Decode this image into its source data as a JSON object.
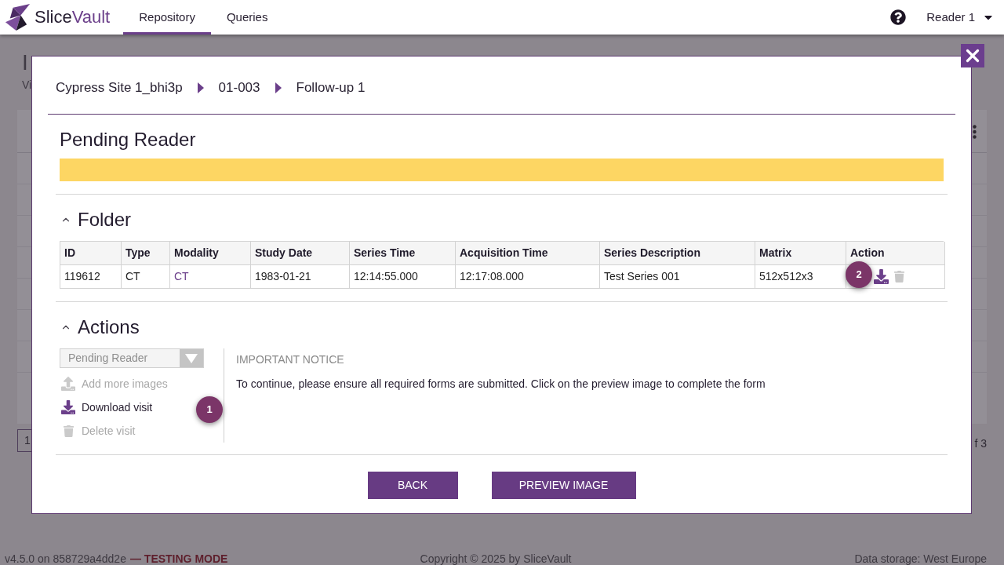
{
  "header": {
    "logo": {
      "text_start": "Slice",
      "text_end": "Vault"
    },
    "tabs": [
      {
        "label": "Repository",
        "selected": true
      },
      {
        "label": "Queries",
        "selected": false
      }
    ],
    "user_menu": {
      "label": "Reader 1"
    }
  },
  "background_page": {
    "title": "I",
    "subtitle": "Vi",
    "pagination": {
      "page": "1",
      "page_count": "f 3"
    }
  },
  "modal": {
    "breadcrumb": [
      "Cypress Site 1_bhi3p",
      "01-003",
      "Follow-up 1"
    ],
    "status_title": "Pending Reader",
    "folder": {
      "title": "Folder",
      "expanded": true,
      "table": {
        "columns": [
          "ID",
          "Type",
          "Modality",
          "Study Date",
          "Series Time",
          "Acquisition Time",
          "Series Description",
          "Matrix",
          "Action"
        ],
        "rows": [
          {
            "cells": [
              {
                "text": "119612",
                "kind": "text"
              },
              {
                "text": "CT",
                "kind": "text"
              },
              {
                "text": "CT",
                "kind": "link"
              },
              {
                "text": "1983-01-21",
                "kind": "text"
              },
              {
                "text": "12:14:55.000",
                "kind": "text"
              },
              {
                "text": "12:17:08.000",
                "kind": "text"
              },
              {
                "text": "Test Series 001",
                "kind": "text"
              },
              {
                "text": "512x512x3",
                "kind": "text"
              }
            ],
            "actions": [
              {
                "kind": "download",
                "disabled": false
              },
              {
                "kind": "delete",
                "disabled": true
              }
            ],
            "tour_marker": "2"
          }
        ]
      }
    },
    "actions": {
      "title": "Actions",
      "expanded": true,
      "status_select": {
        "value": "Pending Reader",
        "disabled": true
      },
      "items": [
        {
          "label": "Add more images",
          "kind": "upload",
          "disabled": true
        },
        {
          "label": "Download visit",
          "kind": "download",
          "disabled": false
        },
        {
          "label": "Delete visit",
          "kind": "delete",
          "disabled": true
        }
      ],
      "tour_marker": "1",
      "notice": {
        "title": "IMPORTANT NOTICE",
        "message": "To continue, please ensure all required forms are submitted. Click on the preview image to complete the form"
      }
    },
    "buttons": [
      "BACK",
      "PREVIEW IMAGE"
    ]
  },
  "footer": {
    "version": "v4.5.0 on 858729a4dd2e",
    "mode": "— TESTING MODE",
    "copyright": "Copyright © 2025 by SliceVault",
    "storage": "Data storage: West Europe"
  }
}
